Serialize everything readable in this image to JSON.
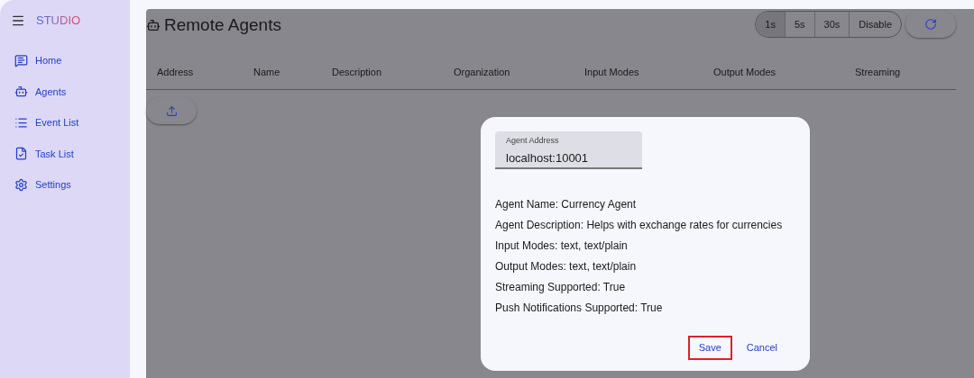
{
  "sidebar": {
    "brand": "STUDIO",
    "items": [
      {
        "kind": "home",
        "label": "Home"
      },
      {
        "kind": "agents",
        "label": "Agents"
      },
      {
        "kind": "events",
        "label": "Event List"
      },
      {
        "kind": "tasks",
        "label": "Task List"
      },
      {
        "kind": "settings",
        "label": "Settings"
      }
    ]
  },
  "page": {
    "title": "Remote Agents",
    "intervals": [
      {
        "label": "1s",
        "selected": true
      },
      {
        "label": "5s",
        "selected": false
      },
      {
        "label": "30s",
        "selected": false
      },
      {
        "label": "Disable",
        "selected": false
      }
    ],
    "table": {
      "columns": [
        "Address",
        "Name",
        "Description",
        "Organization",
        "Input Modes",
        "Output Modes",
        "Streaming"
      ]
    }
  },
  "dialog": {
    "field": {
      "label": "Agent Address",
      "value": "localhost:10001"
    },
    "details": [
      "Agent Name: Currency Agent",
      "Agent Description: Helps with exchange rates for currencies",
      "Input Modes: text, text/plain",
      "Output Modes: text, text/plain",
      "Streaming Supported: True",
      "Push Notifications Supported: True"
    ],
    "buttons": [
      {
        "label": "Save",
        "highlighted": true
      },
      {
        "label": "Cancel",
        "highlighted": false
      }
    ]
  }
}
